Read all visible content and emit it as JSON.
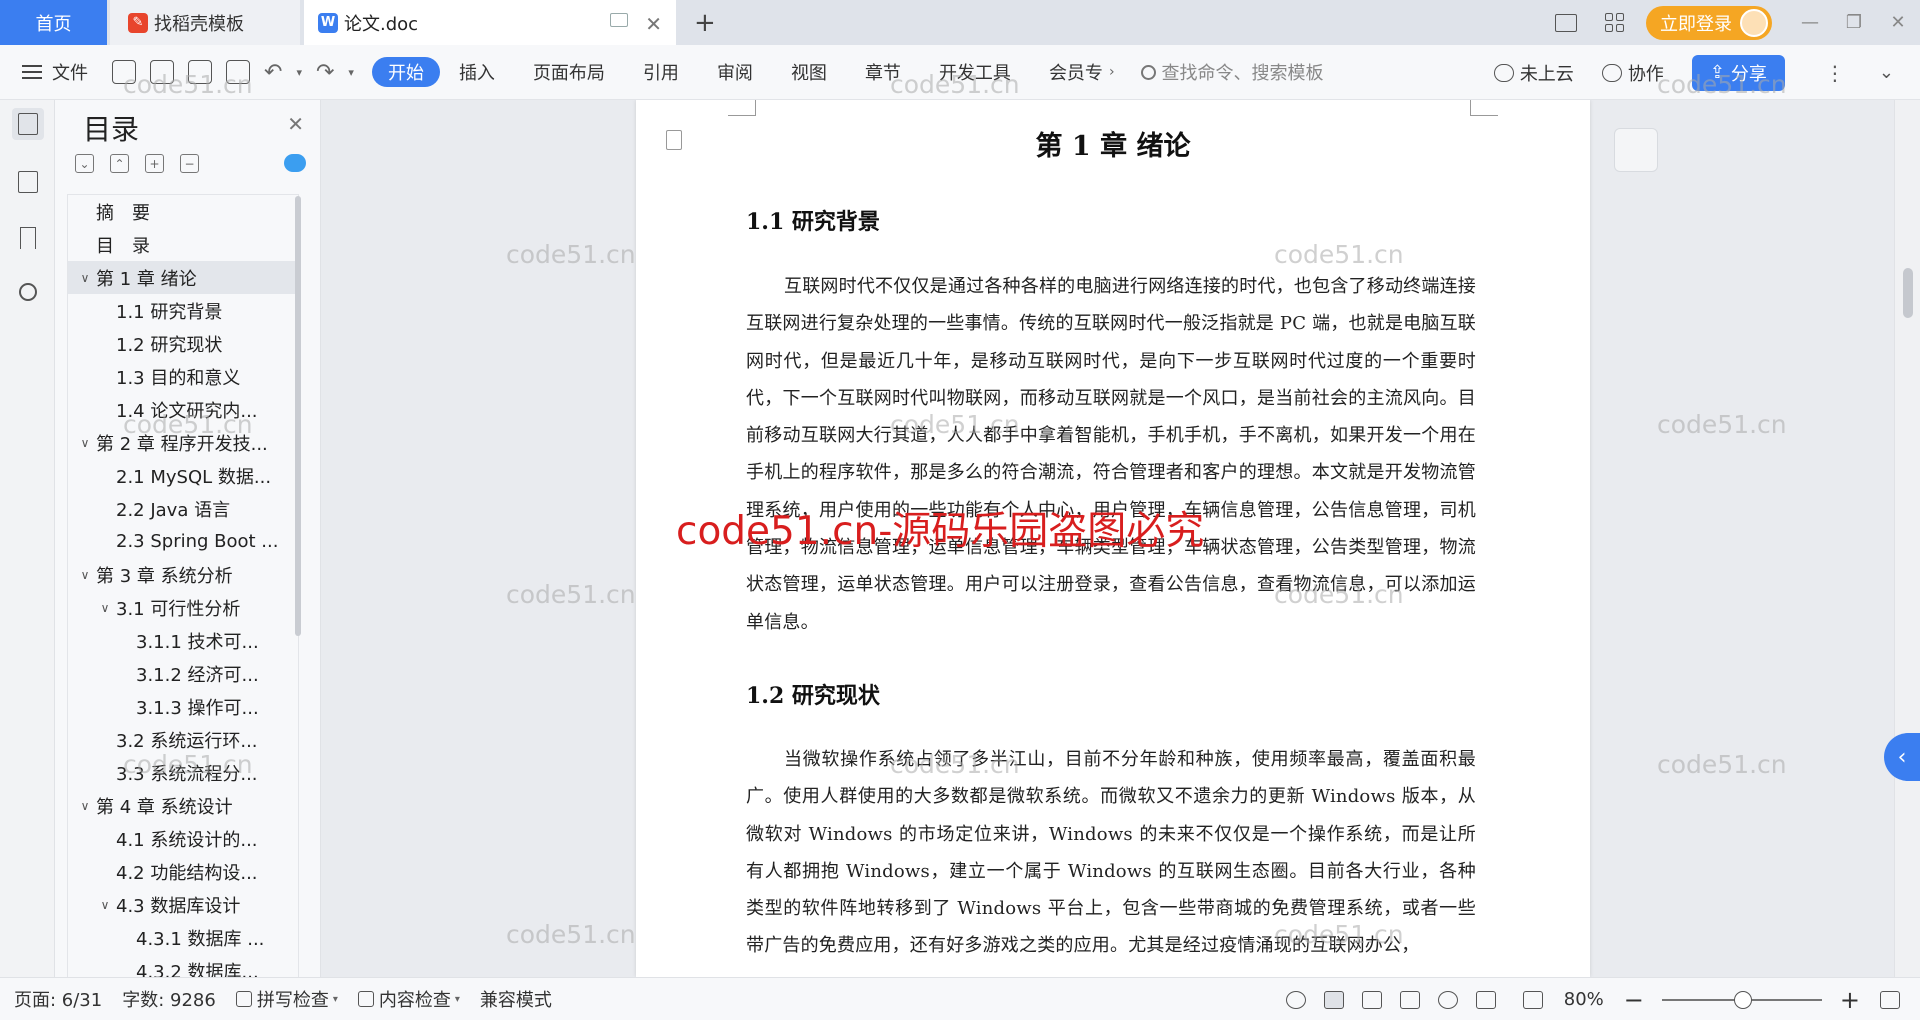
{
  "tabs": {
    "home": "首页",
    "template": "找稻壳模板",
    "document": "论文.doc"
  },
  "titlebar": {
    "login": "立即登录"
  },
  "toolbar": {
    "file": "文件",
    "ribbon_tabs": [
      "开始",
      "插入",
      "页面布局",
      "引用",
      "审阅",
      "视图",
      "章节",
      "开发工具",
      "会员专"
    ],
    "search_placeholder": "查找命令、搜索模板",
    "cloud": "未上云",
    "collab": "协作",
    "share": "分享"
  },
  "toc": {
    "title": "目录",
    "items": [
      {
        "text": "摘　要",
        "level": 1,
        "caret": ""
      },
      {
        "text": "目　录",
        "level": 1,
        "caret": ""
      },
      {
        "text": "第 1 章  绪论",
        "level": 1,
        "caret": "∨",
        "selected": true
      },
      {
        "text": "1.1 研究背景",
        "level": 2,
        "caret": ""
      },
      {
        "text": "1.2 研究现状",
        "level": 2,
        "caret": ""
      },
      {
        "text": "1.3 目的和意义",
        "level": 2,
        "caret": ""
      },
      {
        "text": "1.4 论文研究内...",
        "level": 2,
        "caret": ""
      },
      {
        "text": "第 2 章  程序开发技...",
        "level": 1,
        "caret": "∨"
      },
      {
        "text": "2.1 MySQL 数据...",
        "level": 2,
        "caret": ""
      },
      {
        "text": "2.2 Java 语言",
        "level": 2,
        "caret": ""
      },
      {
        "text": "2.3 Spring Boot ...",
        "level": 2,
        "caret": ""
      },
      {
        "text": "第 3 章  系统分析",
        "level": 1,
        "caret": "∨"
      },
      {
        "text": "3.1 可行性分析",
        "level": 2,
        "caret": "∨"
      },
      {
        "text": "3.1.1 技术可...",
        "level": 3,
        "caret": ""
      },
      {
        "text": "3.1.2 经济可...",
        "level": 3,
        "caret": ""
      },
      {
        "text": "3.1.3 操作可...",
        "level": 3,
        "caret": ""
      },
      {
        "text": "3.2 系统运行环...",
        "level": 2,
        "caret": ""
      },
      {
        "text": "3.3 系统流程分...",
        "level": 2,
        "caret": ""
      },
      {
        "text": "第 4 章  系统设计",
        "level": 1,
        "caret": "∨"
      },
      {
        "text": "4.1 系统设计的...",
        "level": 2,
        "caret": ""
      },
      {
        "text": "4.2 功能结构设...",
        "level": 2,
        "caret": ""
      },
      {
        "text": "4.3 数据库设计",
        "level": 2,
        "caret": "∨"
      },
      {
        "text": "4.3.1 数据库 ...",
        "level": 3,
        "caret": ""
      },
      {
        "text": "4.3.2 数据库...",
        "level": 3,
        "caret": ""
      }
    ]
  },
  "document": {
    "chapter_title": "第 1 章  绪论",
    "section1_title": "1.1  研究背景",
    "section1_text": "互联网时代不仅仅是通过各种各样的电脑进行网络连接的时代，也包含了移动终端连接互联网进行复杂处理的一些事情。传统的互联网时代一般泛指就是 PC 端，也就是电脑互联网时代，但是最近几十年，是移动互联网时代，是向下一步互联网时代过度的一个重要时代，下一个互联网时代叫物联网，而移动互联网就是一个风口，是当前社会的主流风向。目前移动互联网大行其道，人人都手中拿着智能机，手机手机，手不离机，如果开发一个用在手机上的程序软件，那是多么的符合潮流，符合管理者和客户的理想。本文就是开发物流管理系统，用户使用的一些功能有个人中心，用户管理，车辆信息管理，公告信息管理，司机管理，物流信息管理，运单信息管理，车辆类型管理，车辆状态管理，公告类型管理，物流状态管理，运单状态管理。用户可以注册登录，查看公告信息，查看物流信息，可以添加运单信息。",
    "section2_title": "1.2  研究现状",
    "section2_text": "当微软操作系统占领了多半江山，目前不分年龄和种族，使用频率最高，覆盖面积最广。使用人群使用的大多数都是微软系统。而微软又不遗余力的更新 Windows 版本，从微软对 Windows 的市场定位来讲，Windows 的未来不仅仅是一个操作系统，而是让所有人都拥抱 Windows，建立一个属于 Windows 的互联网生态圈。目前各大行业，各种类型的软件阵地转移到了 Windows 平台上，包含一些带商城的免费管理系统，或者一些带广告的免费应用，还有好多游戏之类的应用。尤其是经过疫情涌现的互联网办公，"
  },
  "watermark": {
    "small": "code51.cn",
    "big": "code51.cn-源码乐园盗图必究"
  },
  "statusbar": {
    "page": "页面: 6/31",
    "words": "字数: 9286",
    "spell": "拼写检查",
    "content_check": "内容检查",
    "compat": "兼容模式",
    "zoom": "80%"
  },
  "colors": {
    "accent": "#3b7ef0",
    "login": "#f5a623",
    "watermark_red": "#d81e1e"
  }
}
